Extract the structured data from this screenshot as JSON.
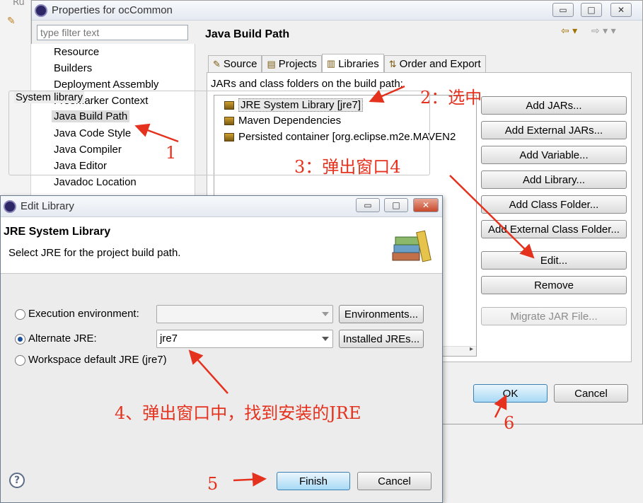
{
  "background": {
    "menu_fragment": "Ru"
  },
  "properties_window": {
    "title": "Properties for ocCommon",
    "buttons": {
      "minimize": "▭",
      "maximize": "□",
      "close": "✕"
    },
    "filter_placeholder": "type filter text",
    "nav_items": [
      "Resource",
      "Builders",
      "Deployment Assembly",
      "FreeMarker Context",
      "Java Build Path",
      "Java Code Style",
      "Java Compiler",
      "Java Editor",
      "Javadoc Location"
    ],
    "page_title": "Java Build Path",
    "tabs": [
      "Source",
      "Projects",
      "Libraries",
      "Order and Export"
    ],
    "active_tab": "Libraries",
    "jars_label": "JARs and class folders on the build path:",
    "libraries": [
      "JRE System Library [jre7]",
      "Maven Dependencies",
      "Persisted container [org.eclipse.m2e.MAVEN2"
    ],
    "side_buttons": [
      "Add JARs...",
      "Add External JARs...",
      "Add Variable...",
      "Add Library...",
      "Add Class Folder...",
      "Add External Class Folder...",
      "Edit...",
      "Remove",
      "Migrate JAR File..."
    ],
    "ok_label": "OK",
    "cancel_label": "Cancel"
  },
  "edit_library": {
    "title": "Edit Library",
    "head_title": "JRE System Library",
    "head_desc": "Select JRE for the project build path.",
    "group_label": "System library",
    "options": {
      "execution_env": "Execution environment:",
      "alternate_jre": "Alternate JRE:",
      "workspace_default": "Workspace default JRE (jre7)"
    },
    "execution_env_value": "",
    "alternate_jre_value": "jre7",
    "environments_button": "Environments...",
    "installed_jres_button": "Installed JREs...",
    "help_label": "?",
    "finish_label": "Finish",
    "cancel_label": "Cancel"
  },
  "annotations": {
    "a1": "1",
    "a2": "2：选中",
    "a3": "3：弹出窗口4",
    "a4": "4、弹出窗口中，找到安装的JRE",
    "a5": "5",
    "a6": "6"
  },
  "colors": {
    "annotation": "#e5321e",
    "dialog_default_button": "#a7d9f5"
  }
}
